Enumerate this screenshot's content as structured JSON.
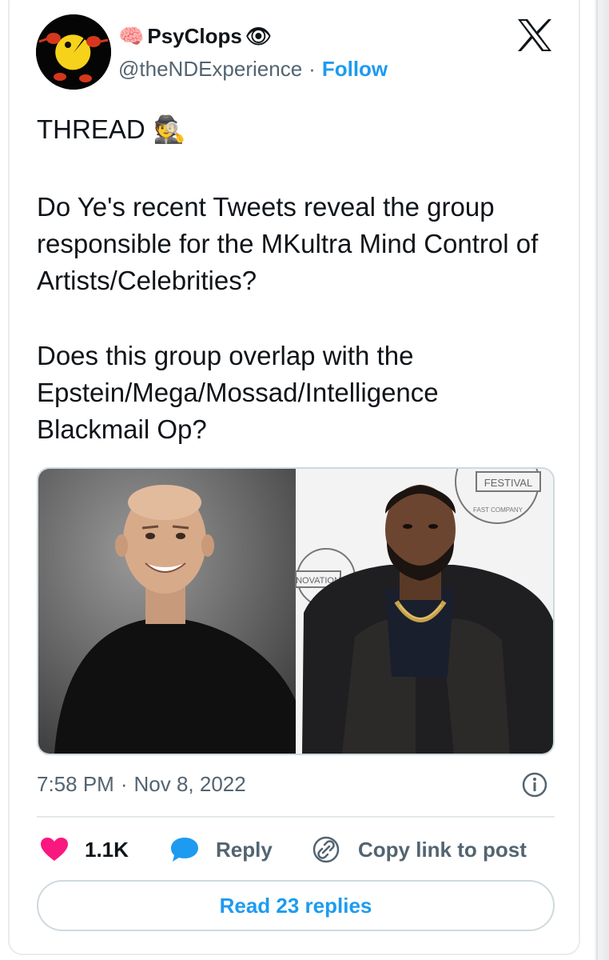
{
  "author": {
    "name_prefix_emoji": "🧠",
    "name": "PsyClops",
    "name_suffix_emoji": "👁",
    "handle": "@theNDExperience",
    "separator": "·",
    "follow_label": "Follow",
    "avatar_icon": "pacman-boxer-avatar"
  },
  "platform_icon": "x-logo-icon",
  "post": {
    "thread_label": "THREAD",
    "thread_emoji": "🕵️",
    "paragraph_1": "Do Ye's recent Tweets reveal the group responsible for the MKultra Mind Control of Artists/Celebrities?",
    "paragraph_2": "Does this group overlap with the Epstein/Mega/Mossad/Intelligence Blackmail Op?"
  },
  "media": {
    "backdrop_badge_top": "FESTIVAL",
    "backdrop_badge_ring": "FAST COMPANY",
    "backdrop_badge_left": "NOVATION"
  },
  "meta": {
    "time": "7:58 PM",
    "separator": "·",
    "date": "Nov 8, 2022"
  },
  "actions": {
    "like_count": "1.1K",
    "reply_label": "Reply",
    "copy_label": "Copy link to post"
  },
  "read_replies_label": "Read 23 replies",
  "colors": {
    "accent": "#1d9bf0",
    "like": "#f91880",
    "text": "#0f1419",
    "secondary": "#536471"
  }
}
